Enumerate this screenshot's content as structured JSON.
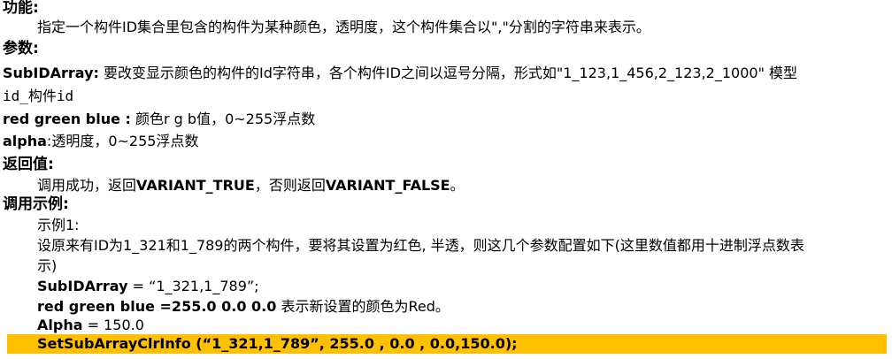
{
  "function_section": {
    "heading": "功能:",
    "description": "指定一个构件ID集合里包含的构件为某种颜色，透明度，这个构件集合以\",\"分割的字符串来表示。"
  },
  "params_section": {
    "heading": "参数:",
    "subid": {
      "name": "SubIDArray:",
      "desc_line1": " 要改变显示颜色的构件的Id字符串，各个构件ID之间以逗号分隔，形式如\"1_123,1_456,2_123,2_1000\"    模型",
      "desc_line2": "id_构件id"
    },
    "rgb": {
      "name": "red green blue :",
      "desc": " 颜色r g b值，0~255浮点数"
    },
    "alpha": {
      "name": "alpha",
      "desc": ":透明度，0~255浮点数"
    }
  },
  "return_section": {
    "heading": "返回值:",
    "text_prefix": "调用成功，返回",
    "true_value": "VARIANT_TRUE",
    "text_middle": "，否则返回",
    "false_value": "VARIANT_FALSE",
    "text_suffix": "。"
  },
  "example_section": {
    "heading": "调用示例:",
    "example_label": "示例1:",
    "scenario_line1": "设原来有ID为1_321和1_789的两个构件，要将其设置为红色, 半透，则这几个参数配置如下(这里数值都用十进制浮点数表",
    "scenario_line2": "示)",
    "subid_label": "SubIDArray",
    "subid_value": " = “1_321,1_789”;",
    "rgb_label": "red green blue",
    "rgb_value": " =255.0  0.0  0.0",
    "rgb_note": "  表示新设置的颜色为Red。",
    "alpha_label": "Alpha",
    "alpha_value": " = 150.0",
    "call_label": "SetSubArrayClrInfo",
    "call_args": " (“1_321,1_789”, 255.0 , 0.0 , 0.0,150.0);",
    "highlight_color": "#ffc000"
  }
}
